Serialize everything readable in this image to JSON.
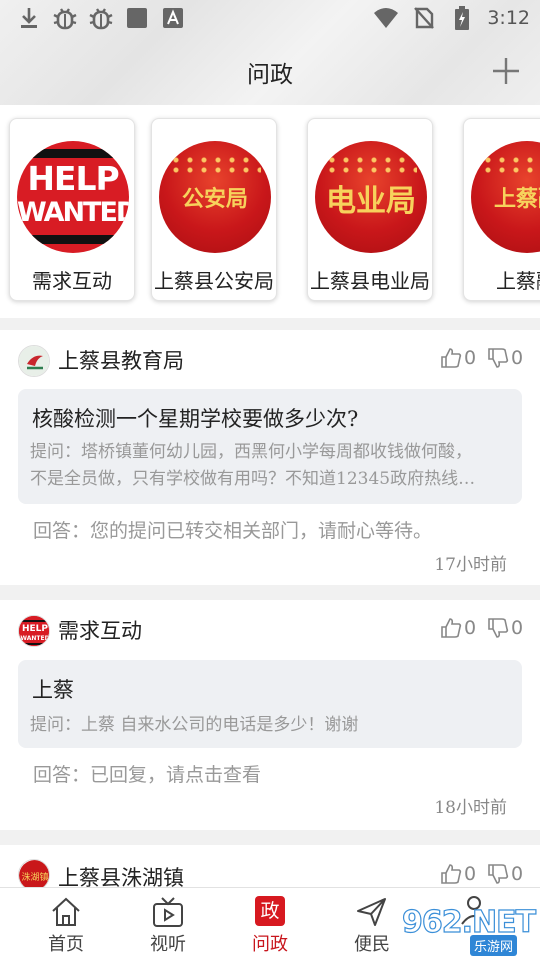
{
  "status_bar": {
    "time": "3:12",
    "left_icons": [
      "download-icon",
      "bug-icon",
      "bug-icon",
      "square-icon",
      "a-box-icon"
    ],
    "right_icons": [
      "wifi-icon",
      "no-sim-icon",
      "battery-charging-icon"
    ]
  },
  "header": {
    "title": "问政",
    "add_icon": "plus-icon"
  },
  "departments": [
    {
      "name": "需求互动",
      "logo_text_1": "HELP",
      "logo_text_2": "WANTED"
    },
    {
      "name": "上蔡县公安局",
      "logo_text": "公安局"
    },
    {
      "name": "上蔡县电业局",
      "logo_text": "电业局"
    },
    {
      "name": "上蔡融",
      "logo_text": "上蔡融"
    }
  ],
  "posts": [
    {
      "dept": "上蔡县教育局",
      "likes": "0",
      "dislikes": "0",
      "question_title": "核酸检测一个星期学校要做多少次?",
      "question_line1": "提问：塔桥镇董何幼儿园，西黑何小学每周都收钱做何酸，",
      "question_line2": "不是全员做，只有学校做有用吗？不知道12345政府热线…",
      "answer": "回答：您的提问已转交相关部门，请耐心等待。",
      "time": "17小时前"
    },
    {
      "dept": "需求互动",
      "likes": "0",
      "dislikes": "0",
      "question_title": "上蔡",
      "question_line1": "提问：上蔡 自来水公司的电话是多少！谢谢",
      "answer": "回答：已回复，请点击查看",
      "time": "18小时前"
    },
    {
      "dept": "上蔡县洙湖镇",
      "likes": "0",
      "dislikes": "0"
    }
  ],
  "nav": {
    "items": [
      {
        "label": "首页",
        "icon": "home-icon"
      },
      {
        "label": "视听",
        "icon": "tv-icon"
      },
      {
        "label": "问政",
        "icon": "zheng-icon",
        "glyph": "政"
      },
      {
        "label": "便民",
        "icon": "send-icon"
      }
    ],
    "active_color": "#c8161d"
  },
  "watermark": {
    "num": "962.NET",
    "sub": "乐游网"
  }
}
